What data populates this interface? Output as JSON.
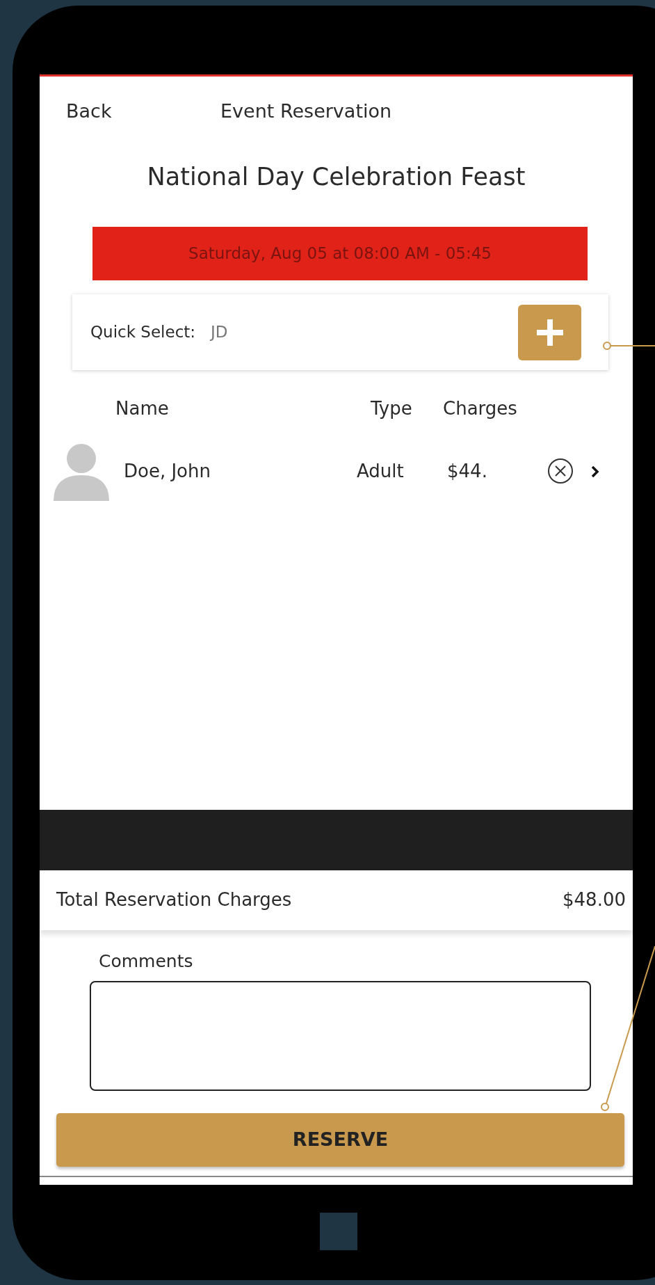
{
  "header": {
    "back": "Back",
    "title": "Event Reservation"
  },
  "event": {
    "title": "National Day Celebration Feast",
    "date": "Saturday, Aug 05 at 08:00 AM - 05:45"
  },
  "quick_select": {
    "label": "Quick Select:",
    "value": "JD"
  },
  "table": {
    "columns": [
      "Name",
      "Type",
      "Charges"
    ],
    "rows": [
      {
        "name": "Doe, John",
        "type": "Adult",
        "charges": "$44."
      }
    ]
  },
  "total": {
    "label": "Total Reservation Charges",
    "value": "$48.00"
  },
  "comments": {
    "label": "Comments"
  },
  "reserve_button": "RESERVE"
}
